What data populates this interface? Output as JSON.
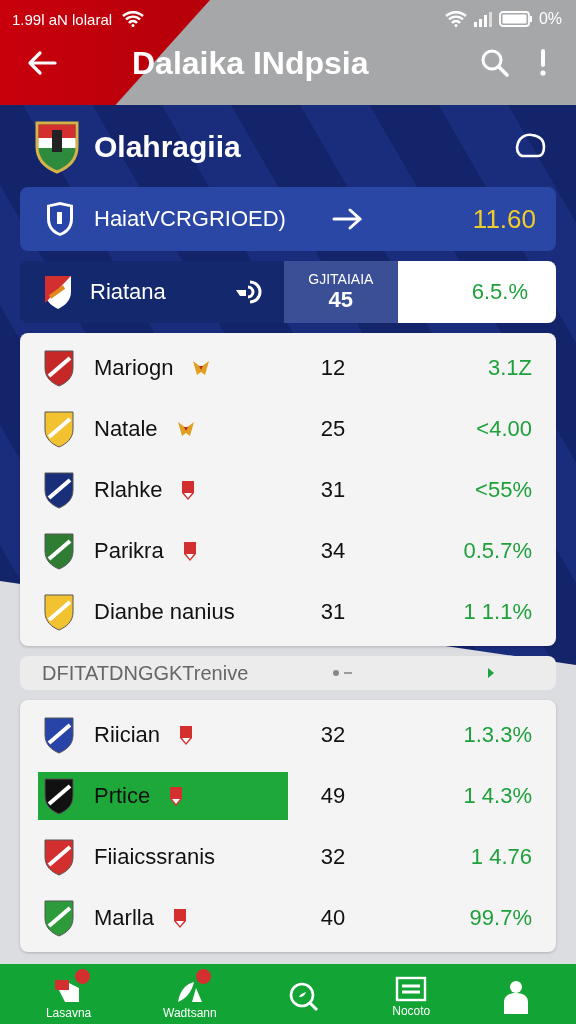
{
  "status_bar": {
    "time": "1.99l aN lolaral",
    "battery": "0%"
  },
  "app_bar": {
    "title": "Dalaika INdpsia"
  },
  "header": {
    "title": "Olahragiia"
  },
  "highlight": {
    "label": "HaiatVCRGRIOED)",
    "value": "11.60"
  },
  "featured": {
    "name": "Riatana",
    "stat_label": "GJITAIAIA",
    "stat_value": "45",
    "percent": "6.5.%"
  },
  "list_1": [
    {
      "name": "Mariogn",
      "kind": "bird",
      "color": "#c62828",
      "value": "12",
      "percent": "3.1Z",
      "selected": false
    },
    {
      "name": "Natale",
      "kind": "bird",
      "color": "#f2c230",
      "value": "25",
      "percent": "<4.00",
      "selected": false
    },
    {
      "name": "Rlahke",
      "kind": "pin",
      "color": "#1a2f7a",
      "value": "31",
      "percent": "<55%",
      "selected": false
    },
    {
      "name": "Parikra",
      "kind": "pin",
      "color": "#2e7d32",
      "value": "34",
      "percent": "0.5.7%",
      "selected": false
    },
    {
      "name": "Dianbe nanius",
      "kind": "plain",
      "color": "#f2c230",
      "value": "31",
      "percent": "1 1.1%",
      "selected": false
    }
  ],
  "section": {
    "title": "DFITATDNGGKTrenive"
  },
  "list_2": [
    {
      "name": "Riician",
      "kind": "pin",
      "color": "#2844a8",
      "value": "32",
      "percent": "1.3.3%",
      "selected": false
    },
    {
      "name": "Prtice",
      "kind": "pin",
      "color": "#111111",
      "value": "49",
      "percent": "1 4.3%",
      "selected": true
    },
    {
      "name": "Fiiaicssranis",
      "kind": "plain",
      "color": "#d32f2f",
      "value": "32",
      "percent": "1 4.76",
      "selected": false
    },
    {
      "name": "Marlla",
      "kind": "pin",
      "color": "#2e9b3a",
      "value": "40",
      "percent": "99.7%",
      "selected": false
    }
  ],
  "nav": [
    {
      "label": "Lasavna",
      "kind": "home",
      "badge": true
    },
    {
      "label": "Wadtsann",
      "kind": "leaf",
      "badge": true
    },
    {
      "kind": "search",
      "badge": false
    },
    {
      "label": "Nocoto",
      "kind": "list",
      "badge": false
    },
    {
      "kind": "person",
      "badge": false
    }
  ]
}
